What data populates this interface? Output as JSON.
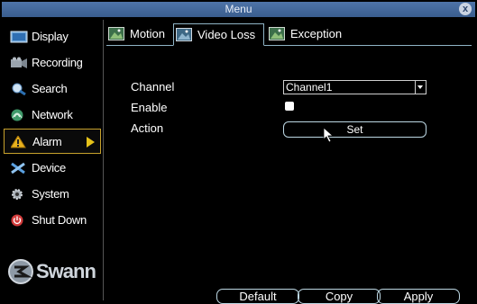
{
  "window": {
    "title": "Menu",
    "close_label": "x"
  },
  "sidebar": {
    "items": [
      {
        "label": "Display",
        "icon": "display-icon"
      },
      {
        "label": "Recording",
        "icon": "recording-icon"
      },
      {
        "label": "Search",
        "icon": "search-icon"
      },
      {
        "label": "Network",
        "icon": "network-icon"
      },
      {
        "label": "Alarm",
        "icon": "alarm-icon",
        "active": true
      },
      {
        "label": "Device",
        "icon": "device-icon"
      },
      {
        "label": "System",
        "icon": "gear-icon"
      },
      {
        "label": "Shut Down",
        "icon": "power-icon"
      }
    ],
    "logo_text": "Swann"
  },
  "tabs": [
    {
      "label": "Motion",
      "icon": "motion-tab-icon"
    },
    {
      "label": "Video Loss",
      "icon": "video-loss-tab-icon",
      "active": true
    },
    {
      "label": "Exception",
      "icon": "exception-tab-icon"
    }
  ],
  "form": {
    "channel_label": "Channel",
    "channel_value": "Channel1",
    "enable_label": "Enable",
    "enable_checked": false,
    "action_label": "Action",
    "set_label": "Set"
  },
  "footer": {
    "default_label": "Default",
    "copy_label": "Copy",
    "apply_label": "Apply"
  },
  "colors": {
    "titlebar": "#3a5d8e",
    "active_border": "#c8a22c",
    "arrow": "#e6c21a",
    "outline": "#bcd7e3"
  }
}
